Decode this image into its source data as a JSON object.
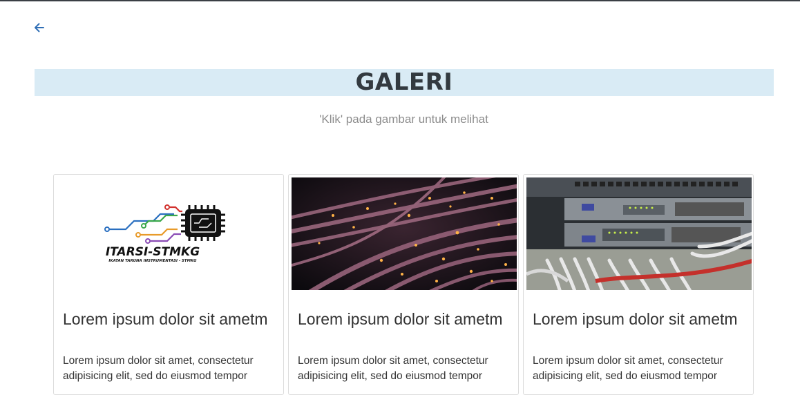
{
  "header": {
    "back_icon": "arrow-left-icon",
    "title": "GALERI",
    "subtitle": "'Klik' pada gambar untuk melihat"
  },
  "colors": {
    "title_bg": "#d9ebf5",
    "accent": "#2f6eb5"
  },
  "gallery": {
    "items": [
      {
        "image": "itarsi-stmkg-logo",
        "logo_text": "ITARSI-STMKG",
        "logo_subtext": "IKATAN TARUNA INSTRUMENTASI - STMKG",
        "title": "Lorem ipsum dolor sit ametm",
        "text": "Lorem ipsum dolor sit amet, consectetur adipisicing elit, sed do eiusmod tempor"
      },
      {
        "image": "fiber-optic-photo",
        "title": "Lorem ipsum dolor sit ametm",
        "text": "Lorem ipsum dolor sit amet, consectetur adipisicing elit, sed do eiusmod tempor"
      },
      {
        "image": "network-switch-photo",
        "title": "Lorem ipsum dolor sit ametm",
        "text": "Lorem ipsum dolor sit amet, consectetur adipisicing elit, sed do eiusmod tempor"
      }
    ]
  }
}
